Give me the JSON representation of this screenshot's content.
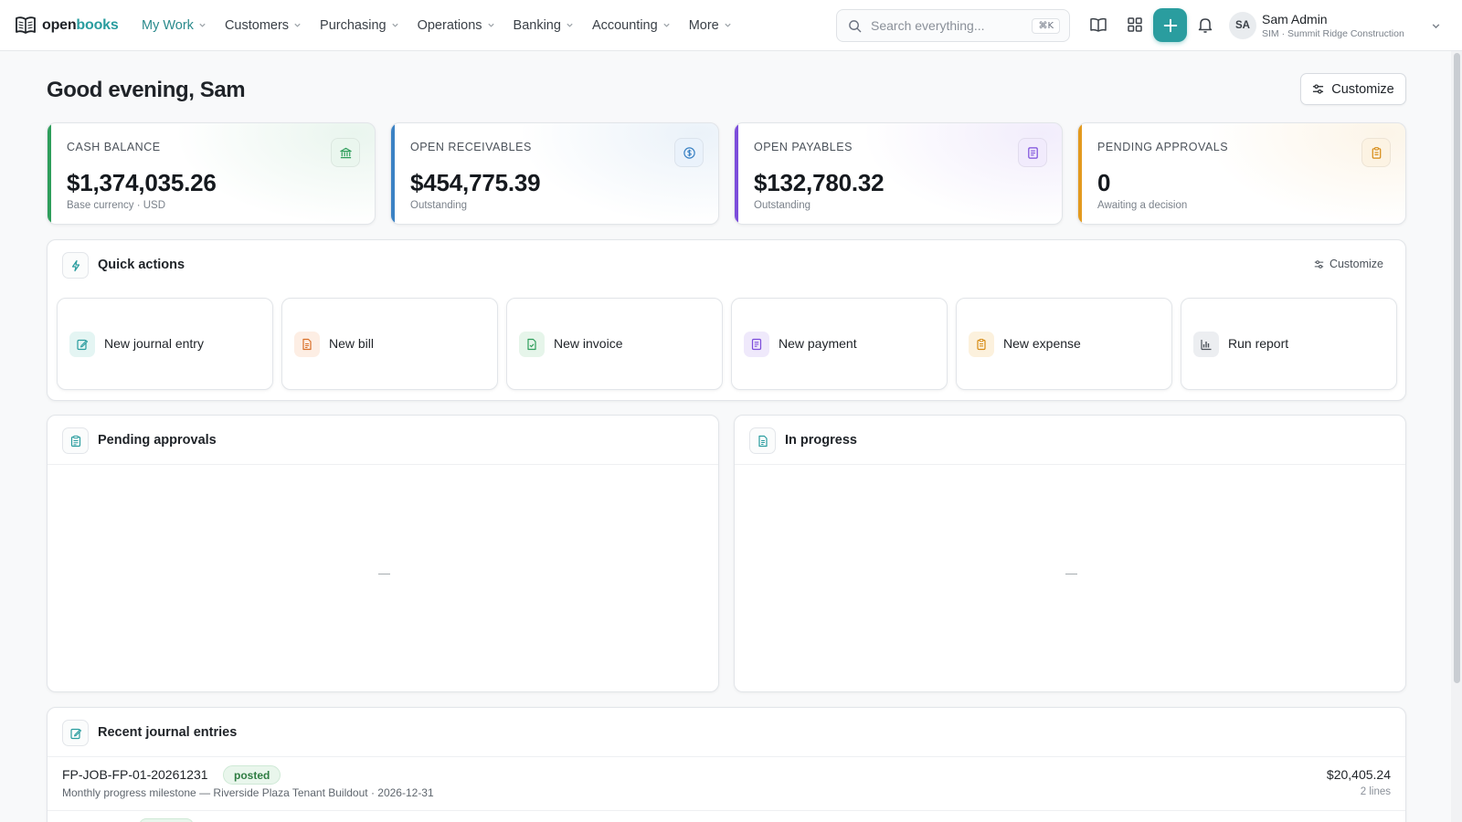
{
  "app": {
    "logo_part1": "open",
    "logo_part2": "books"
  },
  "nav": {
    "items": [
      {
        "label": "My Work",
        "active": true
      },
      {
        "label": "Customers"
      },
      {
        "label": "Purchasing"
      },
      {
        "label": "Operations"
      },
      {
        "label": "Banking"
      },
      {
        "label": "Accounting"
      },
      {
        "label": "More"
      }
    ]
  },
  "search": {
    "placeholder": "Search everything...",
    "shortcut": "⌘K"
  },
  "user": {
    "initials": "SA",
    "name": "Sam Admin",
    "org": "SIM · Summit Ridge Construction"
  },
  "page": {
    "greeting": "Good evening, Sam",
    "customize_label": "Customize"
  },
  "stats": [
    {
      "label": "CASH BALANCE",
      "value": "$1,374,035.26",
      "sub": "Base currency · USD",
      "icon": "bank-icon",
      "color": "#2e9e5b"
    },
    {
      "label": "OPEN RECEIVABLES",
      "value": "$454,775.39",
      "sub": "Outstanding",
      "icon": "dollar-circle-icon",
      "color": "#3b82c4"
    },
    {
      "label": "OPEN PAYABLES",
      "value": "$132,780.32",
      "sub": "Outstanding",
      "icon": "receipt-icon",
      "color": "#7c4ddb"
    },
    {
      "label": "PENDING APPROVALS",
      "value": "0",
      "sub": "Awaiting a decision",
      "icon": "clipboard-icon",
      "color": "#e39a1e"
    }
  ],
  "quick_actions": {
    "title": "Quick actions",
    "customize_label": "Customize",
    "items": [
      {
        "label": "New journal entry",
        "icon": "journal-edit-icon"
      },
      {
        "label": "New bill",
        "icon": "bill-icon"
      },
      {
        "label": "New invoice",
        "icon": "invoice-icon"
      },
      {
        "label": "New payment",
        "icon": "payment-icon"
      },
      {
        "label": "New expense",
        "icon": "expense-icon"
      },
      {
        "label": "Run report",
        "icon": "bar-chart-icon"
      }
    ]
  },
  "pending_approvals": {
    "title": "Pending approvals",
    "empty": "—"
  },
  "in_progress": {
    "title": "In progress",
    "empty": "—"
  },
  "recent_journal_entries": {
    "title": "Recent journal entries",
    "rows": [
      {
        "ref": "FP-JOB-FP-01-20261231",
        "status": "posted",
        "description": "Monthly progress milestone — Riverside Plaza Tenant Buildout · 2026-12-31",
        "amount": "$20,405.24",
        "lines": "2 lines"
      }
    ]
  }
}
